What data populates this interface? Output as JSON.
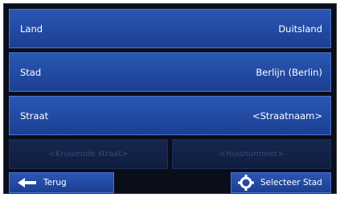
{
  "rows": [
    {
      "label": "Land",
      "value": "Duitsland"
    },
    {
      "label": "Stad",
      "value": "Berlijn (Berlin)"
    },
    {
      "label": "Straat",
      "value": "<Straatnaam>"
    }
  ],
  "disabled": {
    "cross_street": "<Kruisende straat>",
    "house_number": "<Huisnummer>"
  },
  "buttons": {
    "back_label": "Terug",
    "select_city_label": "Selecteer Stad"
  },
  "colors": {
    "row_blue": "#2a57b4",
    "background": "#0a0d1a",
    "disabled_text": "#34497a"
  }
}
